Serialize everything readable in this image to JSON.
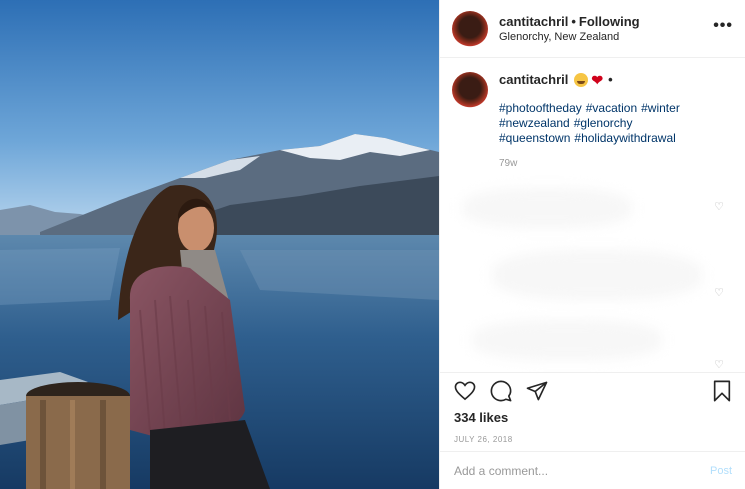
{
  "post": {
    "username": "cantitachril",
    "separator": "•",
    "follow_status": "Following",
    "location": "Glenorchy, New Zealand",
    "more_icon": "more-horizontal-icon"
  },
  "caption": {
    "username": "cantitachril",
    "emoji_1": "crying-face-emoji",
    "emoji_2": "red-heart-emoji",
    "heart_char": "❤",
    "trailing": "•",
    "hashtags": [
      "#photooftheday",
      "#vacation",
      "#winter",
      "#newzealand",
      "#glenorchy",
      "#queenstown",
      "#holidaywithdrawal"
    ],
    "age": "79w"
  },
  "comment_like_icon": "♡",
  "actions": {
    "like_icon": "heart-outline-icon",
    "comment_icon": "comment-bubble-icon",
    "share_icon": "paper-plane-icon",
    "save_icon": "bookmark-icon"
  },
  "likes": "334 likes",
  "date": "JULY 26, 2018",
  "comment_box": {
    "placeholder": "Add a comment...",
    "post_label": "Post"
  },
  "colors": {
    "hashtag": "#003569",
    "post_disabled": "#b2dffc",
    "muted": "#999999"
  }
}
